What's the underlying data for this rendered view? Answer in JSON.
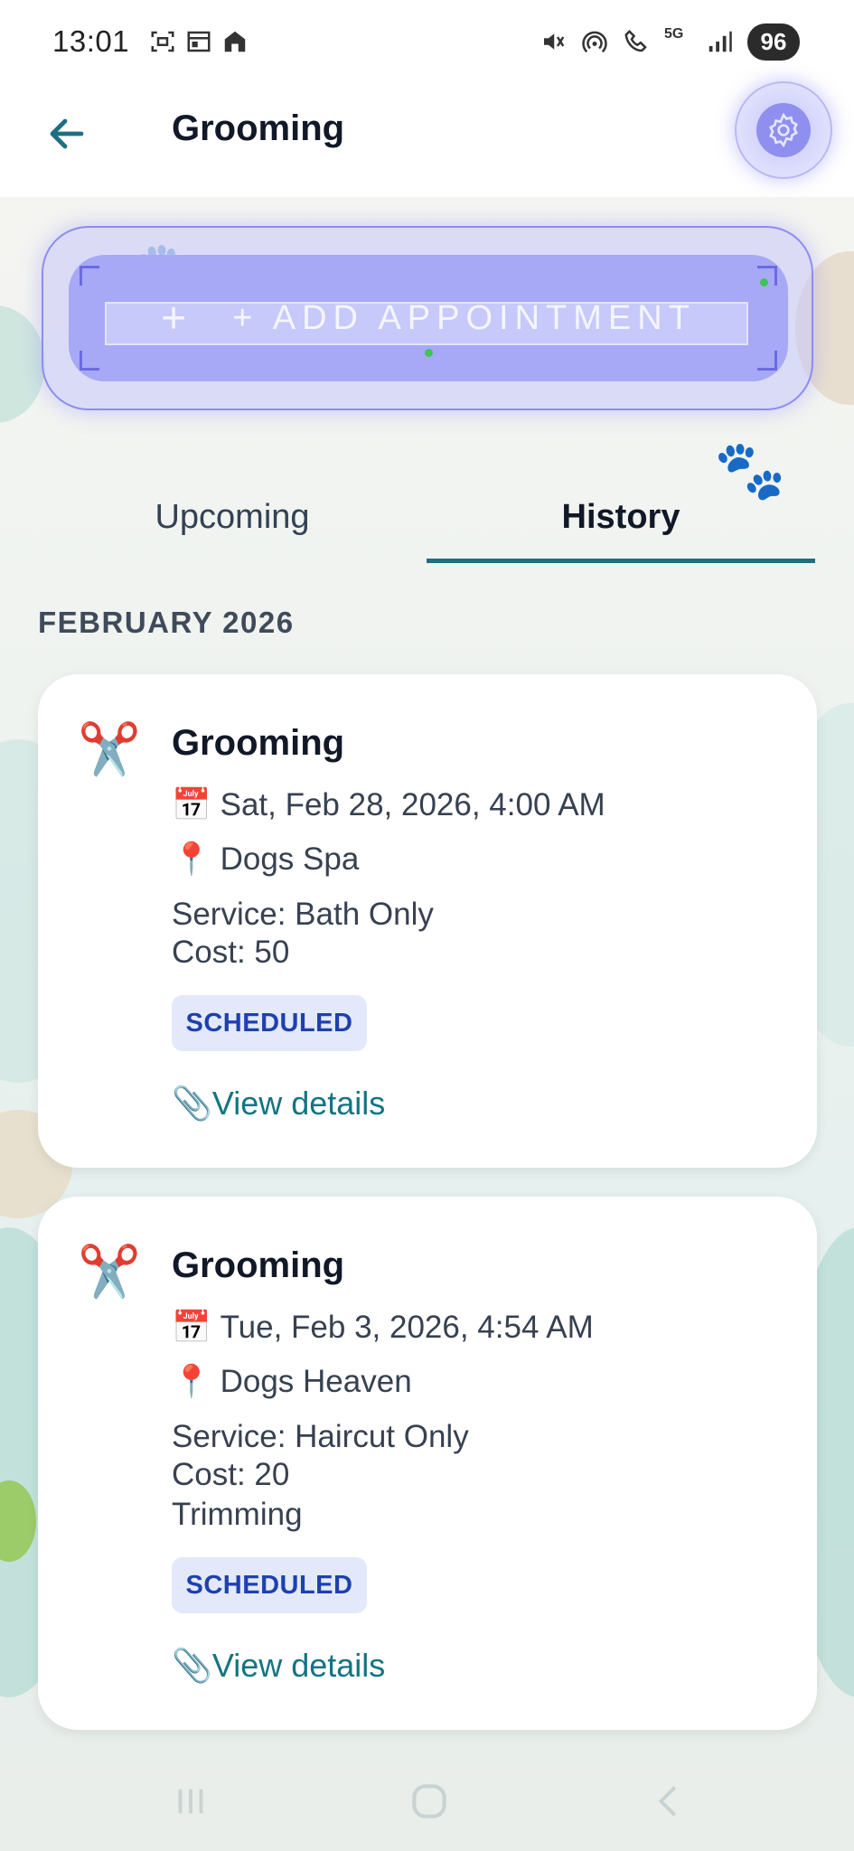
{
  "status_bar": {
    "time": "13:01",
    "battery": "96",
    "network": "5G",
    "icons_left": [
      "screenshot-icon",
      "calendar-icon",
      "home-app-icon"
    ],
    "icons_right": [
      "mute-icon",
      "hotspot-icon",
      "wifi-call-icon",
      "network-5g-icon",
      "signal-icon"
    ]
  },
  "app_bar": {
    "title": "Grooming",
    "back_icon": "arrow-left-icon",
    "settings_icon": "gear-icon"
  },
  "add_button": {
    "label": "+ ADD APPOINTMENT",
    "icon": "plus-icon"
  },
  "tabs": [
    {
      "label": "Upcoming",
      "active": false
    },
    {
      "label": "History",
      "active": true
    }
  ],
  "month": "FEBRUARY 2026",
  "appointments": [
    {
      "icon": "✂️",
      "title": "Grooming",
      "date": "Sat, Feb 28, 2026, 4:00 AM",
      "location": "Dogs Spa",
      "service": "Service: Bath Only",
      "cost": "Cost: 50",
      "notes": "",
      "status": "SCHEDULED",
      "link": "View details"
    },
    {
      "icon": "✂️",
      "title": "Grooming",
      "date": "Tue, Feb 3, 2026, 4:54 AM",
      "location": "Dogs Heaven",
      "service": "Service: Haircut Only",
      "cost": "Cost: 20",
      "notes": "Trimming",
      "status": "SCHEDULED",
      "link": "View details"
    }
  ],
  "colors": {
    "accent": "#1f6f82",
    "link": "#137482",
    "badge_bg": "#e3e9fb",
    "badge_text": "#1e40af",
    "add_button": "#a7a8f6"
  },
  "nav_bar": {
    "recent": "recent-apps-icon",
    "home": "home-icon",
    "back": "back-icon"
  }
}
